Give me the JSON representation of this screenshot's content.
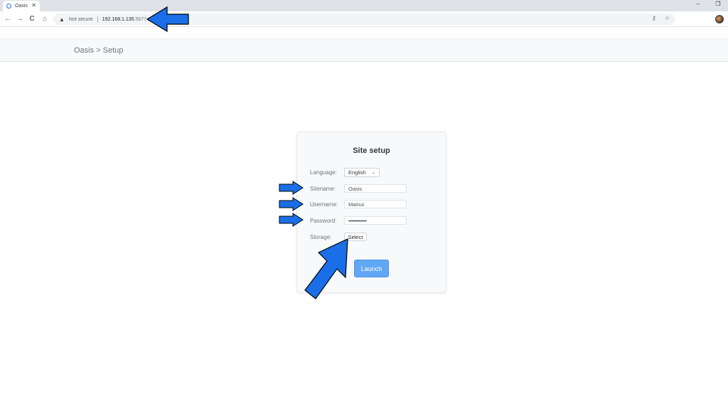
{
  "browser": {
    "tab_title": "Oasis",
    "tab_close": "✕",
    "window_controls": [
      "–",
      "❐"
    ],
    "nav": {
      "back": "←",
      "forward": "→",
      "reload": "C",
      "home": "⌂"
    },
    "address": {
      "warning_icon": "▲",
      "security_label": "Not secure",
      "host": "192.168.1.135",
      "port": ":5677"
    },
    "omnibox_icons": {
      "key": "⚷",
      "star": "☆"
    }
  },
  "app": {
    "breadcrumb": "Oasis > Setup"
  },
  "setup": {
    "title": "Site setup",
    "language": {
      "label": "Language:",
      "value": "English",
      "chevron": "⌄"
    },
    "sitename": {
      "label": "Sitename:",
      "value": "Oasis"
    },
    "username": {
      "label": "Username:",
      "value": "Marius"
    },
    "password": {
      "label": "Password:",
      "value": "••••••••••••"
    },
    "storage": {
      "label": "Storage:",
      "button": "Select"
    },
    "launch_button": "Launch"
  },
  "colors": {
    "arrow_fill": "#1a6fe8",
    "arrow_stroke": "#000000",
    "launch_bg": "#62a7f5"
  }
}
